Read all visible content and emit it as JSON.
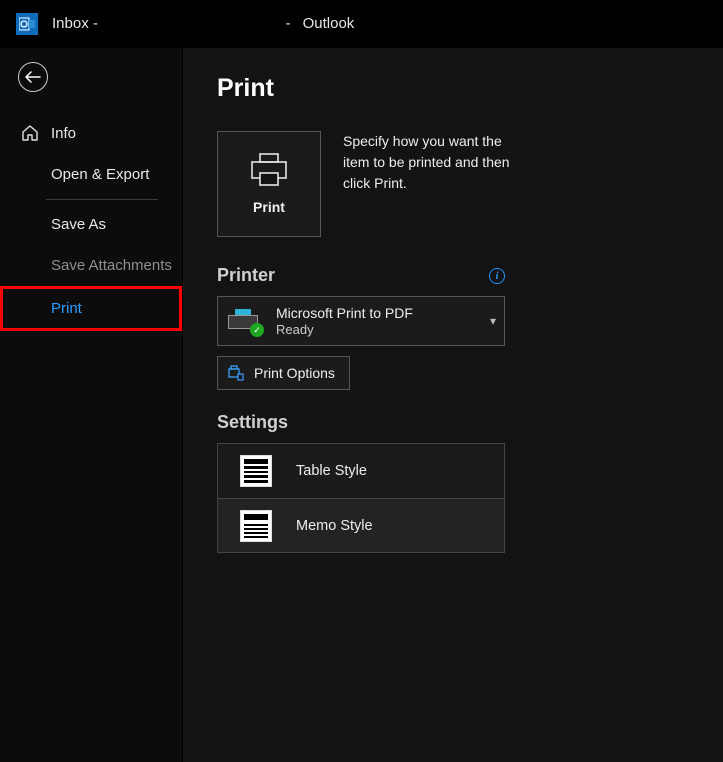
{
  "titlebar": {
    "prefix": "Inbox -",
    "dash": "-",
    "app": "Outlook"
  },
  "sidebar": {
    "info": "Info",
    "open_export": "Open & Export",
    "save_as": "Save As",
    "save_attachments": "Save Attachments",
    "print": "Print"
  },
  "main": {
    "title": "Print",
    "print_button": "Print",
    "description": "Specify how you want the item to be printed and then click Print.",
    "printer_heading": "Printer",
    "selected_printer": {
      "name": "Microsoft Print to PDF",
      "status": "Ready"
    },
    "print_options": "Print Options",
    "settings_heading": "Settings",
    "styles": {
      "table": "Table Style",
      "memo": "Memo Style"
    }
  }
}
